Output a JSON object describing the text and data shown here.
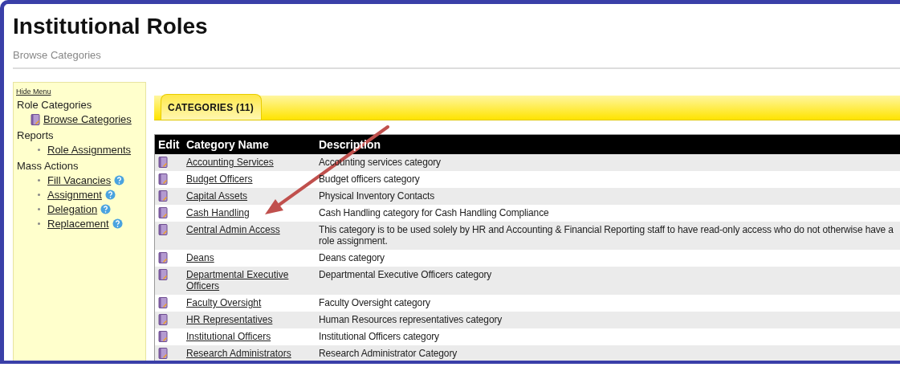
{
  "page": {
    "title": "Institutional Roles",
    "subtitle": "Browse Categories"
  },
  "sidebar": {
    "hide_link": "Hide Menu",
    "sections": [
      {
        "label": "Role Categories",
        "items": [
          {
            "label": "Browse Categories",
            "kind": "book",
            "help": false
          }
        ]
      },
      {
        "label": "Reports",
        "items": [
          {
            "label": "Role Assignments",
            "kind": "bullet",
            "help": false
          }
        ]
      },
      {
        "label": "Mass Actions",
        "items": [
          {
            "label": "Fill Vacancies",
            "kind": "bullet",
            "help": true
          },
          {
            "label": "Assignment",
            "kind": "bullet",
            "help": true
          },
          {
            "label": "Delegation",
            "kind": "bullet",
            "help": true
          },
          {
            "label": "Replacement",
            "kind": "bullet",
            "help": true
          }
        ]
      }
    ]
  },
  "tabs": [
    {
      "label": "CATEGORIES (11)",
      "selected": true
    }
  ],
  "table": {
    "columns": [
      "Edit",
      "Category Name",
      "Description"
    ],
    "rows": [
      {
        "name": "Accounting Services",
        "description": "Accounting services category"
      },
      {
        "name": "Budget Officers",
        "description": "Budget officers category"
      },
      {
        "name": "Capital Assets",
        "description": "Physical Inventory Contacts"
      },
      {
        "name": "Cash Handling",
        "description": "Cash Handling category for Cash Handling Compliance"
      },
      {
        "name": "Central Admin Access",
        "description": "This category is to be used solely by HR and Accounting & Financial Reporting staff to have read-only access who do not otherwise have a role assignment."
      },
      {
        "name": "Deans",
        "description": "Deans category"
      },
      {
        "name": "Departmental Executive Officers",
        "description": "Departmental Executive Officers category"
      },
      {
        "name": "Faculty Oversight",
        "description": "Faculty Oversight category"
      },
      {
        "name": "HR Representatives",
        "description": "Human Resources representatives category"
      },
      {
        "name": "Institutional Officers",
        "description": "Institutional Officers category"
      },
      {
        "name": "Research Administrators",
        "description": "Research Administrator Category"
      }
    ]
  }
}
